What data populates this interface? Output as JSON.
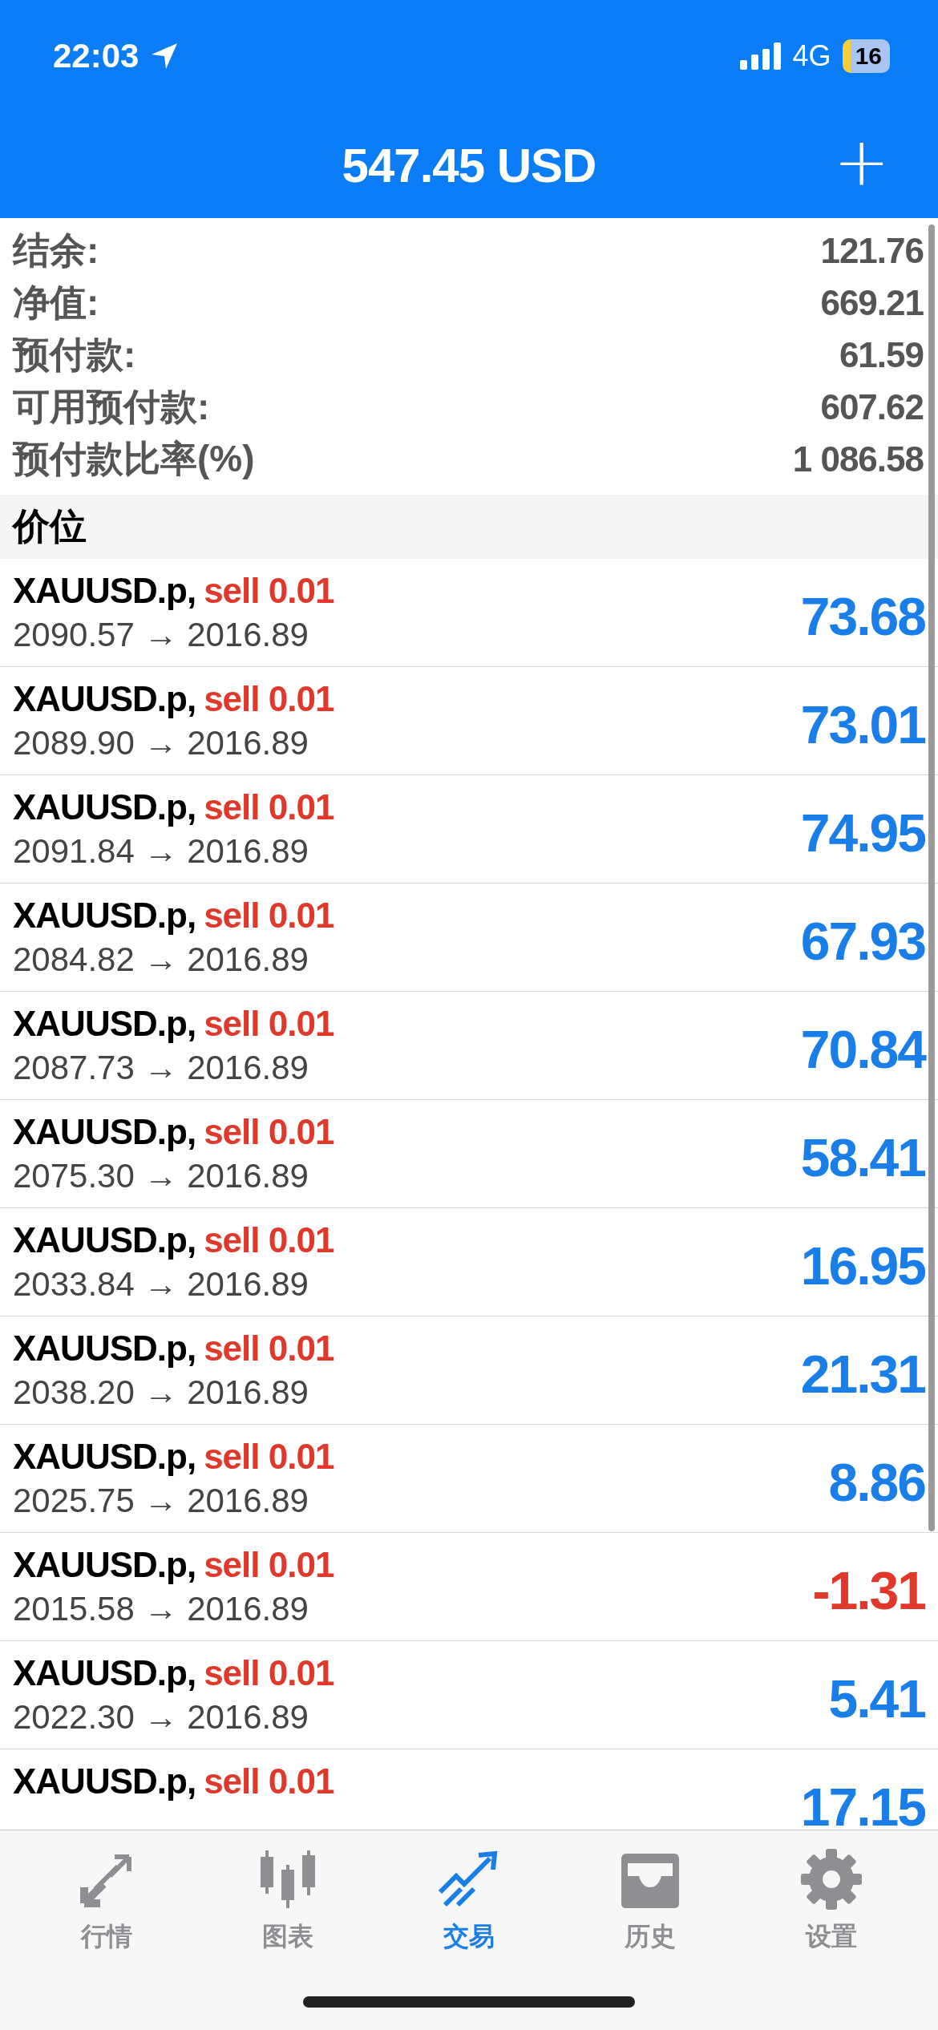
{
  "status_bar": {
    "time": "22:03",
    "network": "4G",
    "battery": "16"
  },
  "header": {
    "title": "547.45 USD",
    "add_button": "+"
  },
  "summary": [
    {
      "label": "结余:",
      "value": "121.76"
    },
    {
      "label": "净值:",
      "value": "669.21"
    },
    {
      "label": "预付款:",
      "value": "61.59"
    },
    {
      "label": "可用预付款:",
      "value": "607.62"
    },
    {
      "label": "预付款比率(%)",
      "value": "1 086.58"
    }
  ],
  "section": {
    "title": "价位"
  },
  "positions": [
    {
      "symbol": "XAUUSD.p,",
      "order": "sell 0.01",
      "prices": "2090.57 → 2016.89",
      "profit": "73.68",
      "loss": false
    },
    {
      "symbol": "XAUUSD.p,",
      "order": "sell 0.01",
      "prices": "2089.90 → 2016.89",
      "profit": "73.01",
      "loss": false
    },
    {
      "symbol": "XAUUSD.p,",
      "order": "sell 0.01",
      "prices": "2091.84 → 2016.89",
      "profit": "74.95",
      "loss": false
    },
    {
      "symbol": "XAUUSD.p,",
      "order": "sell 0.01",
      "prices": "2084.82 → 2016.89",
      "profit": "67.93",
      "loss": false
    },
    {
      "symbol": "XAUUSD.p,",
      "order": "sell 0.01",
      "prices": "2087.73 → 2016.89",
      "profit": "70.84",
      "loss": false
    },
    {
      "symbol": "XAUUSD.p,",
      "order": "sell 0.01",
      "prices": "2075.30 → 2016.89",
      "profit": "58.41",
      "loss": false
    },
    {
      "symbol": "XAUUSD.p,",
      "order": "sell 0.01",
      "prices": "2033.84 → 2016.89",
      "profit": "16.95",
      "loss": false
    },
    {
      "symbol": "XAUUSD.p,",
      "order": "sell 0.01",
      "prices": "2038.20 → 2016.89",
      "profit": "21.31",
      "loss": false
    },
    {
      "symbol": "XAUUSD.p,",
      "order": "sell 0.01",
      "prices": "2025.75 → 2016.89",
      "profit": "8.86",
      "loss": false
    },
    {
      "symbol": "XAUUSD.p,",
      "order": "sell 0.01",
      "prices": "2015.58 → 2016.89",
      "profit": "-1.31",
      "loss": true
    },
    {
      "symbol": "XAUUSD.p,",
      "order": "sell 0.01",
      "prices": "2022.30 → 2016.89",
      "profit": "5.41",
      "loss": false
    },
    {
      "symbol": "XAUUSD.p,",
      "order": "sell 0.01",
      "profit": "17.15",
      "loss": false
    }
  ],
  "tabs": [
    {
      "label": "行情",
      "kind": "quotes",
      "selected": false
    },
    {
      "label": "图表",
      "kind": "chart",
      "selected": false
    },
    {
      "label": "交易",
      "kind": "trade",
      "selected": true
    },
    {
      "label": "历史",
      "kind": "history",
      "selected": false
    },
    {
      "label": "设置",
      "kind": "settings",
      "selected": false
    }
  ]
}
